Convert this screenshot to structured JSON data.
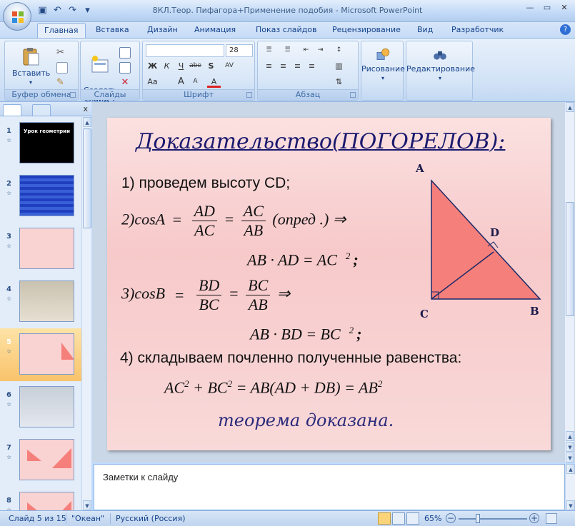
{
  "window": {
    "title": "8КЛ.Теор. Пифагора+Применение подобия - Microsoft PowerPoint"
  },
  "ribbon_tabs": [
    "Главная",
    "Вставка",
    "Дизайн",
    "Анимация",
    "Показ слайдов",
    "Рецензирование",
    "Вид",
    "Разработчик"
  ],
  "ribbon": {
    "clipboard": {
      "label": "Буфер обмена",
      "paste": "Вставить"
    },
    "slides": {
      "label": "Слайды",
      "new_slide": "Создать\nслайд"
    },
    "font": {
      "label": "Шрифт",
      "font_name": "",
      "font_size": "28",
      "bold": "Ж",
      "italic": "К",
      "underline": "Ч",
      "strike": "abe",
      "shadow": "S",
      "spacing": "AV",
      "grow": "A",
      "shrink": "A",
      "case": "Aa",
      "color": "A"
    },
    "paragraph": {
      "label": "Абзац"
    },
    "drawing": {
      "label": "Рисование"
    },
    "editing": {
      "label": "Редактирование"
    }
  },
  "thumbnails": [
    {
      "number": "1",
      "title": "Урок геометрии"
    },
    {
      "number": "2",
      "title": ""
    },
    {
      "number": "3",
      "title": ""
    },
    {
      "number": "4",
      "title": ""
    },
    {
      "number": "5",
      "title": ""
    },
    {
      "number": "6",
      "title": ""
    },
    {
      "number": "7",
      "title": ""
    },
    {
      "number": "8",
      "title": ""
    }
  ],
  "slide": {
    "title": "Доказательство(ПОГОРЕЛОВ):",
    "step1": "1) проведем высоту CD;",
    "cosA": {
      "prefix": "2)cosA",
      "eq": "=",
      "f1_num": "AD",
      "f1_den": "AC",
      "f2_num": "AC",
      "f2_den": "AB",
      "suffix": "(опред .) ⇒"
    },
    "result1": "AB  · AD  =  AC",
    "result1_exp": "2",
    "result1_end": ";",
    "cosB": {
      "prefix": "3)cosB",
      "eq": "=",
      "f1_num": "BD",
      "f1_den": "BC",
      "f2_num": "BC",
      "f2_den": "AB",
      "suffix": "⇒"
    },
    "result2": "AB  · BD  =  BC",
    "result2_exp": "2",
    "result2_end": ";",
    "step4": "4) складываем почленно полученные равенства:",
    "final": {
      "a": "AC",
      "p1": "+ BC",
      "p2": "= AB(AD + DB) = AB",
      "exp": "2"
    },
    "conclusion": "теорема доказана.",
    "labels": {
      "A": "A",
      "B": "B",
      "C": "C",
      "D": "D"
    }
  },
  "notes_placeholder": "Заметки к слайду",
  "status": {
    "slide_of": "Слайд 5 из 15",
    "theme": "\"Океан\"",
    "language": "Русский (Россия)",
    "zoom": "65%"
  },
  "colors": {
    "triangle_fill": "#f57f7a",
    "slide_title": "#1a1a6e",
    "selected_thumb": "#f9c36b"
  }
}
